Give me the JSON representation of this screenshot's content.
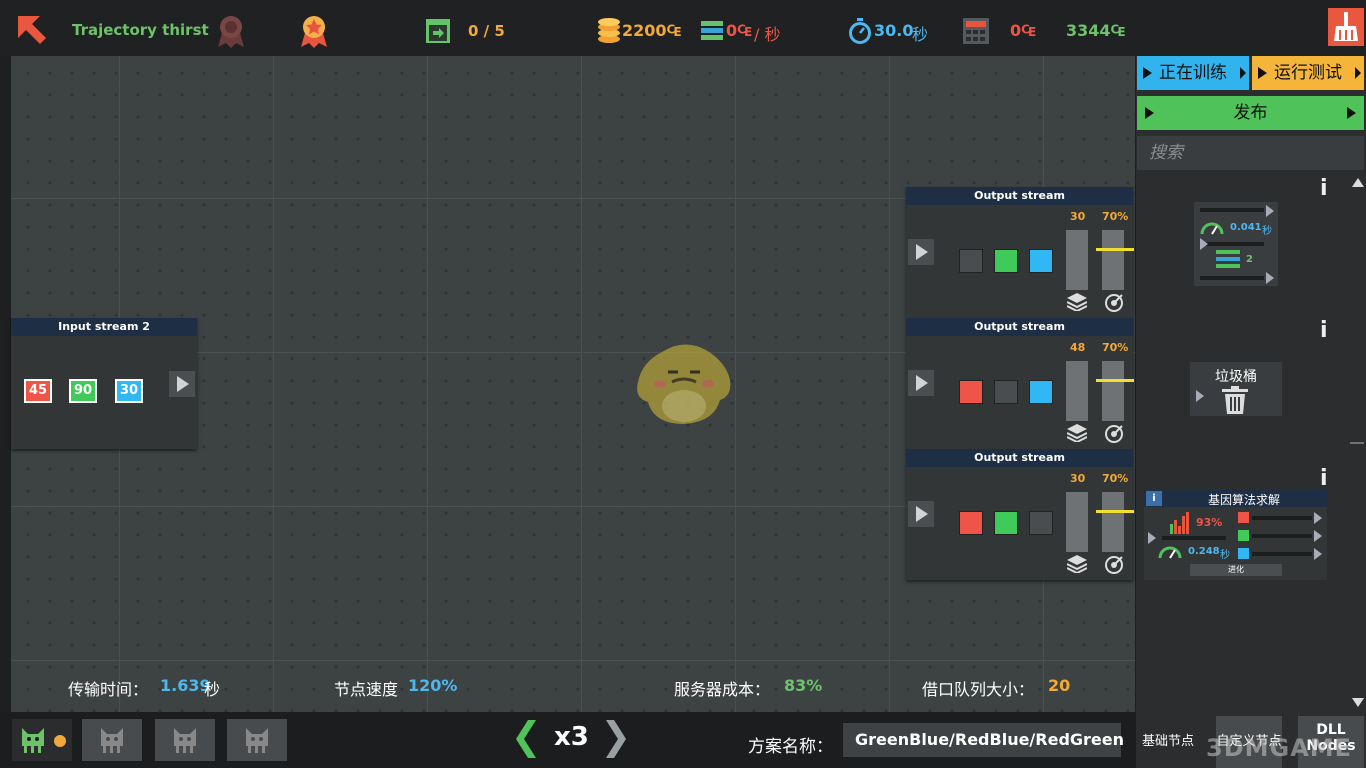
{
  "topbar": {
    "title": "Trajectory thirst",
    "level_progress": "0 / 5",
    "money": "2200₠",
    "rate_value": "0₠",
    "rate_unit": "/ 秒",
    "timer_value": "30.0",
    "timer_unit": "秒",
    "cost": "0₠",
    "total": "3344₠",
    "colors": {
      "green": "#6dc26a",
      "orange": "#f2a93b",
      "blue": "#4db8f0",
      "red": "#ef5547"
    }
  },
  "input_node": {
    "title": "Input stream 2",
    "values": [
      "45",
      "90",
      "30"
    ]
  },
  "output_nodes": [
    {
      "title": "Output stream",
      "count": "30",
      "percent": "70%",
      "colors": [
        "#4a4d4f",
        "#3fca5a",
        "#30b8f5"
      ],
      "level": 0.7
    },
    {
      "title": "Output stream",
      "count": "48",
      "percent": "70%",
      "colors": [
        "#ef5547",
        "#4a4d4f",
        "#30b8f5"
      ],
      "level": 0.7
    },
    {
      "title": "Output stream",
      "count": "30",
      "percent": "70%",
      "colors": [
        "#ef5547",
        "#3fca5a",
        "#4a4d4f"
      ],
      "level": 0.7
    }
  ],
  "stats": {
    "transfer_label": "传输时间：",
    "transfer_value": "1.639",
    "transfer_unit": "秒",
    "speed_label": "节点速度",
    "speed_value": "120%",
    "server_label": "服务器成本：",
    "server_value": "83%",
    "queue_label": "借口队列大小：",
    "queue_value": "20"
  },
  "bottombar": {
    "speed": "x3",
    "plan_label": "方案名称：",
    "plan_name": "GreenBlue/RedBlue/RedGreen"
  },
  "sidebar": {
    "training_label": "正在训练",
    "test_label": "运行测试",
    "publish_label": "发布",
    "search_placeholder": "搜索",
    "info_glyph": "i",
    "card_router": {
      "time": "0.041",
      "time_unit": "秒",
      "count": "2"
    },
    "card_trash": {
      "title": "垃圾桶"
    },
    "card_ga": {
      "title": "基因算法求解",
      "info": "i",
      "percent": "93%",
      "time": "0.248",
      "time_unit": "秒",
      "evolve_label": "进化"
    },
    "tabs": {
      "basic": "基础节点",
      "custom": "自定义节点",
      "dll_line1": "DLL",
      "dll_line2": "Nodes"
    }
  },
  "watermark": "3DMGAME"
}
